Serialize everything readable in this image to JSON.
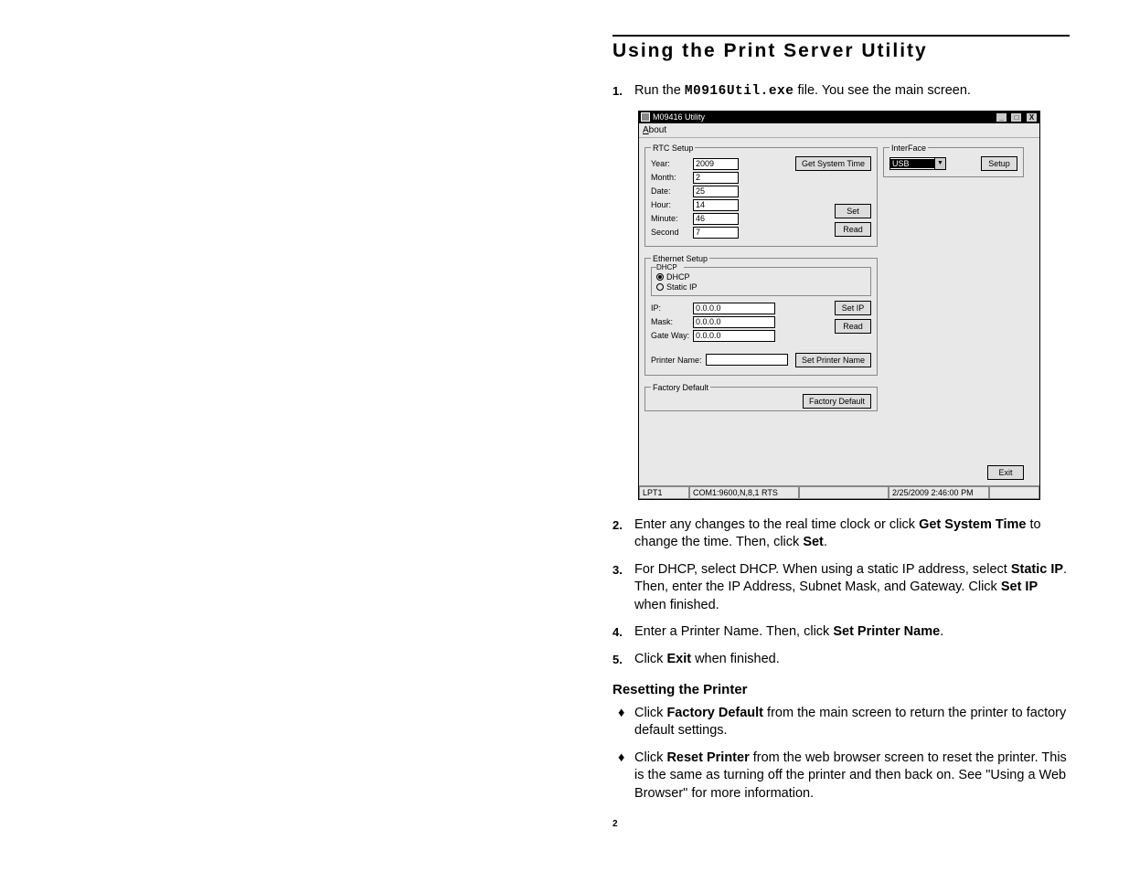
{
  "heading": "Using the Print Server Utility",
  "step1": {
    "num": "1.",
    "pre": "Run the ",
    "exe": "M0916Util.exe",
    "post": " file.  You see the main screen."
  },
  "win": {
    "title": "M09416 Utility",
    "menu_about": "About",
    "rtc": {
      "legend": "RTC Setup",
      "year_lbl": "Year:",
      "year": "2009",
      "month_lbl": "Month:",
      "month": "2",
      "date_lbl": "Date:",
      "date": "25",
      "hour_lbl": "Hour:",
      "hour": "14",
      "minute_lbl": "Minute:",
      "minute": "46",
      "second_lbl": "Second",
      "second": "7",
      "getsys": "Get System Time",
      "set": "Set",
      "read": "Read"
    },
    "iface": {
      "legend": "InterFace",
      "sel": "USB",
      "setup": "Setup"
    },
    "eth": {
      "legend": "Ethernet Setup",
      "dhcp_legend": "DHCP",
      "dhcp": "DHCP",
      "static": "Static IP",
      "ip_lbl": "IP:",
      "ip": "0.0.0.0",
      "mask_lbl": "Mask:",
      "mask": "0.0.0.0",
      "gw_lbl": "Gate Way:",
      "gw": "0.0.0.0",
      "setip": "Set IP",
      "read": "Read",
      "pn_lbl": "Printer Name:",
      "pn": "",
      "setpn": "Set Printer Name"
    },
    "fd": {
      "legend": "Factory Default",
      "btn": "Factory Default"
    },
    "exit": "Exit",
    "status": {
      "lpt": "LPT1",
      "com": "COM1:9600,N,8,1 RTS",
      "dt": "2/25/2009 2:46:00 PM"
    }
  },
  "step2": {
    "num": "2.",
    "t1": "Enter any changes to the real time clock or click ",
    "b1": "Get System Time",
    "t2": " to change the time.  Then, click ",
    "b2": "Set",
    "t3": "."
  },
  "step3": {
    "num": "3.",
    "t1": "For DHCP, select DHCP.  When using a static IP address, select ",
    "b1": "Static IP",
    "t2": ".  Then, enter the IP Address, Subnet Mask, and Gateway.  Click ",
    "b2": "Set IP",
    "t3": " when finished."
  },
  "step4": {
    "num": "4.",
    "t1": "Enter a Printer Name.  Then, click ",
    "b1": "Set Printer Name",
    "t2": "."
  },
  "step5": {
    "num": "5.",
    "t1": "Click ",
    "b1": "Exit",
    "t2": " when finished."
  },
  "sub": "Resetting the Printer",
  "bul1": {
    "t1": "Click ",
    "b1": "Factory Default",
    "t2": " from the main screen to return the printer to factory default settings."
  },
  "bul2": {
    "t1": "Click ",
    "b1": "Reset Printer",
    "t2": " from the web browser screen to reset the printer.  This is the same as turning off the printer and then back on.  See \"Using a Web Browser\" for more information."
  },
  "pagenum": "2"
}
